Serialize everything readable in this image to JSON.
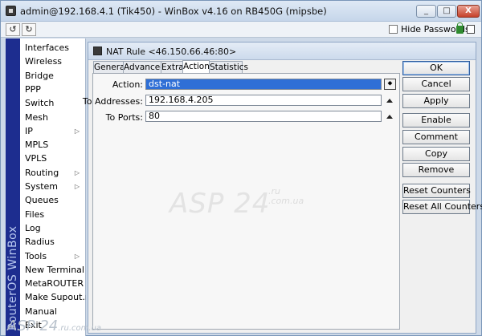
{
  "window": {
    "title": "admin@192.168.4.1 (Tik450) - WinBox v4.16 on RB450G (mipsbe)",
    "controls": {
      "minimize": "_",
      "maximize": "□",
      "close": "X"
    }
  },
  "toolbar": {
    "undo_glyph": "↺",
    "redo_glyph": "↻",
    "hide_passwords_label": "Hide Passwords"
  },
  "brand_strip": "RouterOS WinBox",
  "sidebar": {
    "items": [
      {
        "label": "Interfaces",
        "submenu": false
      },
      {
        "label": "Wireless",
        "submenu": false
      },
      {
        "label": "Bridge",
        "submenu": false
      },
      {
        "label": "PPP",
        "submenu": false
      },
      {
        "label": "Switch",
        "submenu": false
      },
      {
        "label": "Mesh",
        "submenu": false
      },
      {
        "label": "IP",
        "submenu": true
      },
      {
        "label": "MPLS",
        "submenu": false
      },
      {
        "label": "VPLS",
        "submenu": false
      },
      {
        "label": "Routing",
        "submenu": true
      },
      {
        "label": "System",
        "submenu": true
      },
      {
        "label": "Queues",
        "submenu": false
      },
      {
        "label": "Files",
        "submenu": false
      },
      {
        "label": "Log",
        "submenu": false
      },
      {
        "label": "Radius",
        "submenu": false
      },
      {
        "label": "Tools",
        "submenu": true
      },
      {
        "label": "New Terminal",
        "submenu": false
      },
      {
        "label": "MetaROUTER",
        "submenu": false
      },
      {
        "label": "Make Supout.rif",
        "submenu": false
      },
      {
        "label": "Manual",
        "submenu": false
      },
      {
        "label": "Exit",
        "submenu": false
      }
    ],
    "submenu_glyph": "▷"
  },
  "dialog": {
    "title": "NAT Rule <46.150.66.46:80>",
    "tabs": [
      {
        "label": "General",
        "active": false
      },
      {
        "label": "Advanced",
        "active": false
      },
      {
        "label": "Extra",
        "active": false
      },
      {
        "label": "Action",
        "active": true
      },
      {
        "label": "Statistics",
        "active": false
      }
    ],
    "fields": {
      "action": {
        "label": "Action:",
        "value": "dst-nat"
      },
      "to_addresses": {
        "label": "To Addresses:",
        "value": "192.168.4.205"
      },
      "to_ports": {
        "label": "To Ports:",
        "value": "80"
      }
    },
    "dropdown_glyph": "⯁",
    "buttons": {
      "ok": "OK",
      "cancel": "Cancel",
      "apply": "Apply",
      "enable": "Enable",
      "comment": "Comment",
      "copy": "Copy",
      "remove": "Remove",
      "reset_counters": "Reset Counters",
      "reset_all_counters": "Reset All Counters"
    }
  },
  "watermark": {
    "main": "ASP 24",
    "sub_ru": ".ru",
    "sub_com": ".com.ua",
    "bottom_main": "ASP 24",
    "bottom_sub": ".ru",
    "bottom_sub2": ".com.ua"
  },
  "colors": {
    "selection": "#2f6fd6",
    "brand_strip": "#1d2d8f",
    "window_frame": "#cdd9e8",
    "close_button": "#c5412a"
  }
}
